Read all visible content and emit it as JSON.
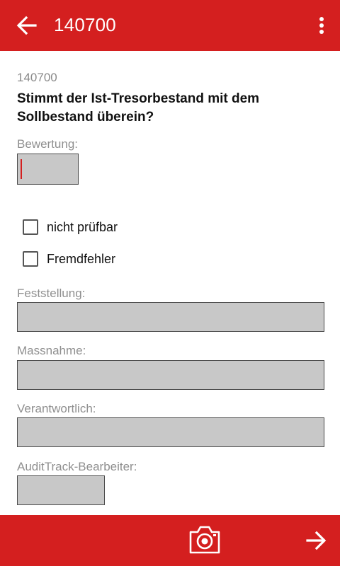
{
  "colors": {
    "brand": "#d41f1f",
    "field_bg": "#c8c8c8",
    "label_gray": "#8f8f8f"
  },
  "appbar": {
    "title": "140700",
    "back_icon": "arrow-left-icon",
    "menu_icon": "more-vertical-icon"
  },
  "main": {
    "subtitle": "140700",
    "question": "Stimmt der Ist-Tresorbestand mit dem Sollbestand überein?",
    "bewertung": {
      "label": "Bewertung:",
      "value": ""
    },
    "checkboxes": [
      {
        "label": "nicht prüfbar",
        "checked": false
      },
      {
        "label": "Fremdfehler",
        "checked": false
      }
    ],
    "feststellung": {
      "label": "Feststellung:",
      "value": ""
    },
    "massnahme": {
      "label": "Massnahme:",
      "value": ""
    },
    "verantwortlich": {
      "label": "Verantwortlich:",
      "value": ""
    },
    "bearbeiter": {
      "label": "AuditTrack-Bearbeiter:",
      "value": ""
    }
  },
  "bottombar": {
    "camera_icon": "camera-icon",
    "next_icon": "arrow-right-icon"
  }
}
